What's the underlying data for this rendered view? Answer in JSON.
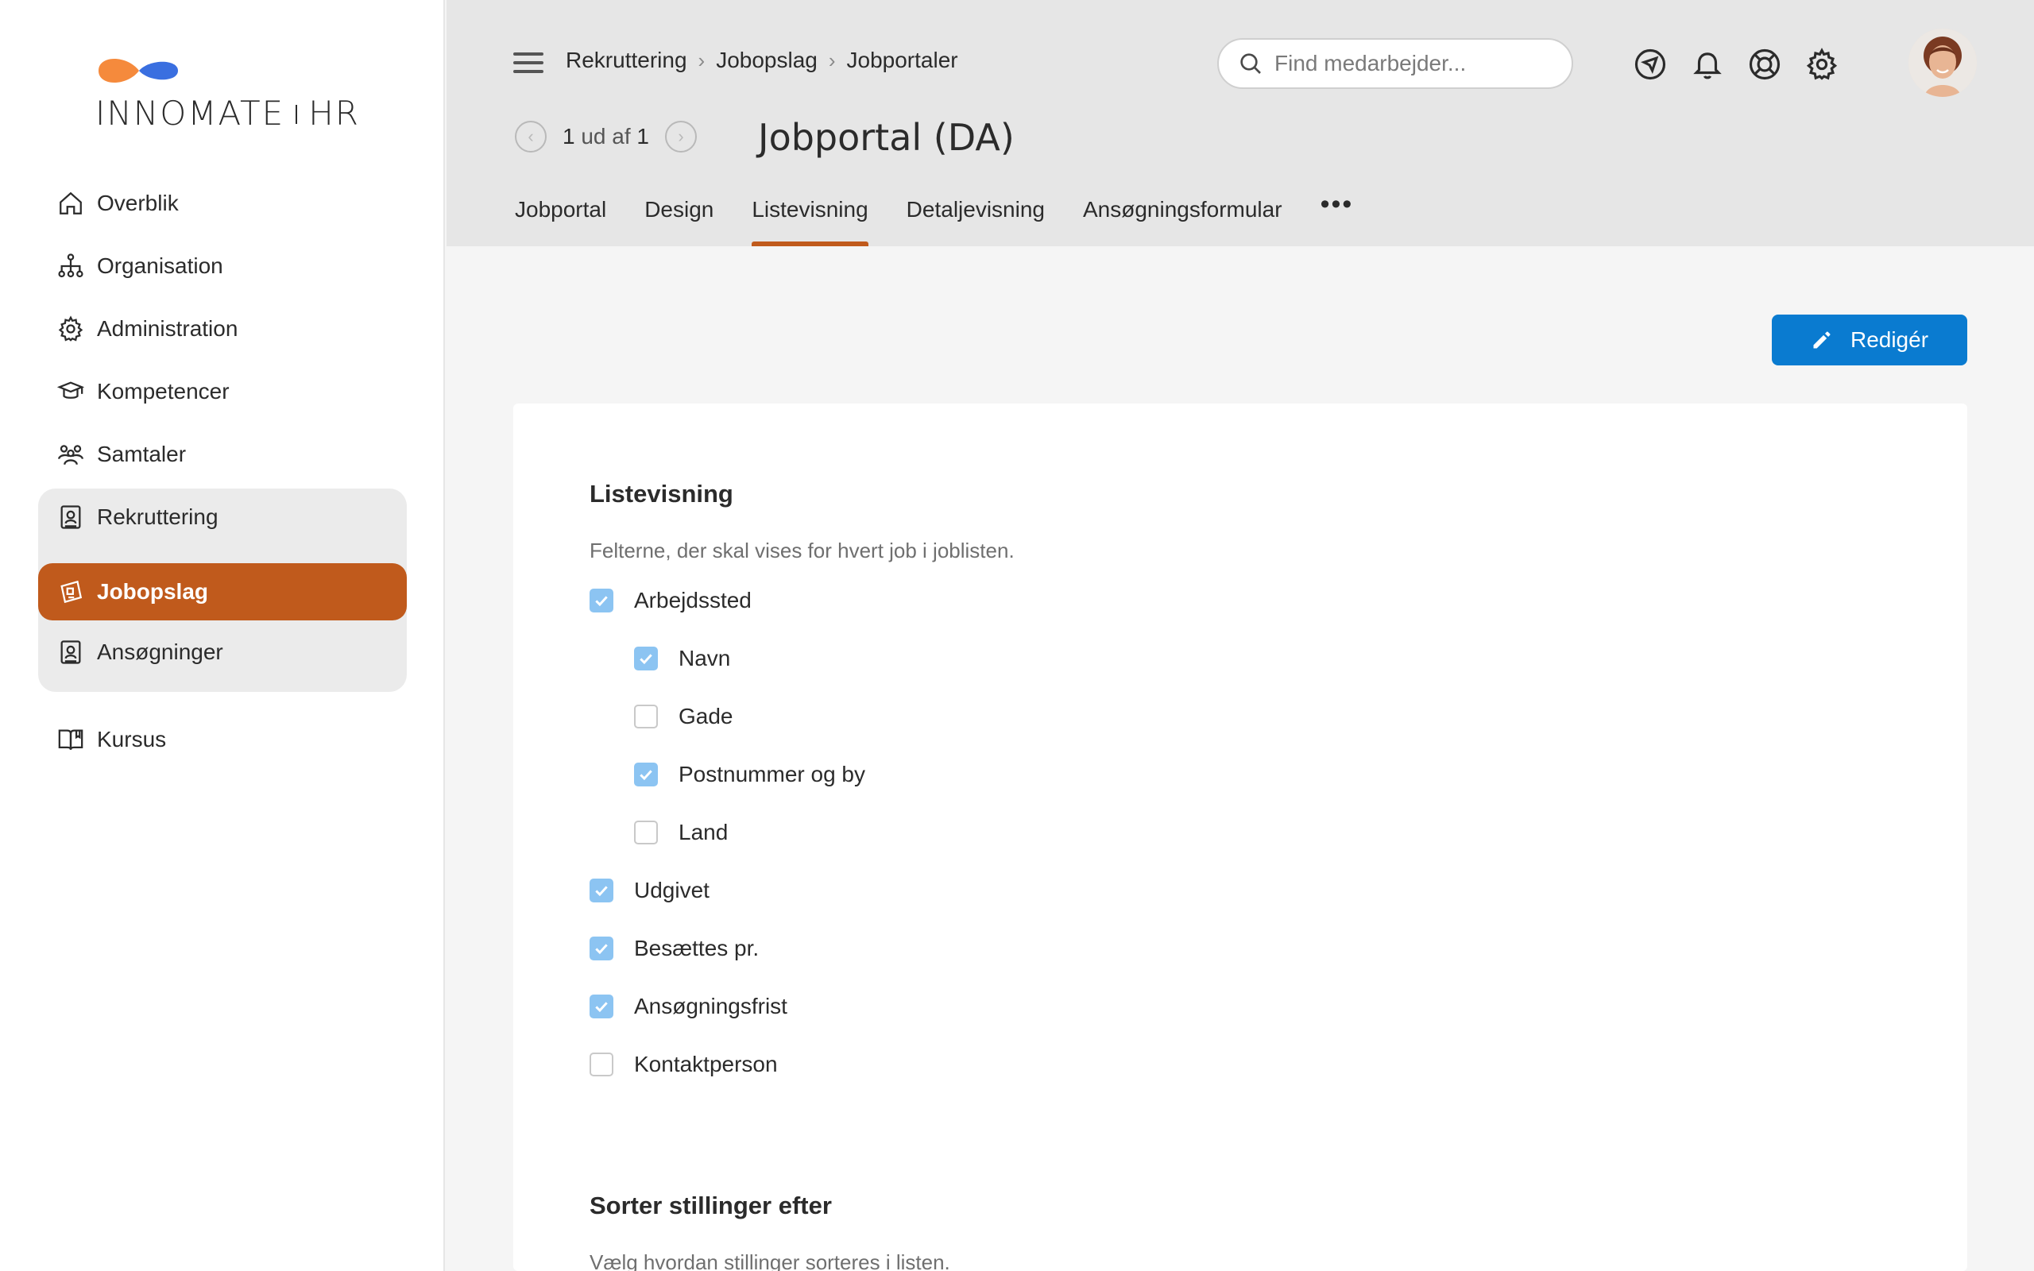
{
  "brand": {
    "name_left": "INNOMATE",
    "name_right": "HR",
    "mark_colors": [
      "#f58a3c",
      "#3a6fe0"
    ]
  },
  "sidebar": {
    "items": [
      {
        "label": "Overblik",
        "icon": "home-icon"
      },
      {
        "label": "Organisation",
        "icon": "org-chart-icon"
      },
      {
        "label": "Administration",
        "icon": "gear-icon"
      },
      {
        "label": "Kompetencer",
        "icon": "graduation-cap-icon"
      },
      {
        "label": "Samtaler",
        "icon": "people-icon"
      },
      {
        "label": "Rekruttering",
        "icon": "id-badge-icon"
      },
      {
        "label": "Jobopslag",
        "icon": "job-post-icon",
        "active": true
      },
      {
        "label": "Ansøgninger",
        "icon": "id-badge-icon"
      },
      {
        "label": "Kursus",
        "icon": "book-icon"
      }
    ]
  },
  "header": {
    "breadcrumb": [
      "Rekruttering",
      "Jobopslag",
      "Jobportaler"
    ],
    "search_placeholder": "Find medarbejder...",
    "pager": {
      "current": "1",
      "separator": "ud af",
      "total": "1"
    },
    "title": "Jobportal (DA)",
    "tabs": [
      {
        "label": "Jobportal"
      },
      {
        "label": "Design"
      },
      {
        "label": "Listevisning",
        "active": true
      },
      {
        "label": "Detaljevisning"
      },
      {
        "label": "Ansøgningsformular"
      }
    ],
    "more_label": "•••",
    "icons": [
      "navigation-icon",
      "bell-icon",
      "lifebuoy-icon",
      "settings-icon"
    ]
  },
  "toolbar": {
    "edit_label": "Redigér",
    "accent": "#0a7bd0"
  },
  "listevisning": {
    "title": "Listevisning",
    "description": "Felterne, der skal vises for hvert job i joblisten.",
    "fields": [
      {
        "label": "Arbejdssted",
        "checked": true,
        "level": 0
      },
      {
        "label": "Navn",
        "checked": true,
        "level": 1
      },
      {
        "label": "Gade",
        "checked": false,
        "level": 1
      },
      {
        "label": "Postnummer og by",
        "checked": true,
        "level": 1
      },
      {
        "label": "Land",
        "checked": false,
        "level": 1
      },
      {
        "label": "Udgivet",
        "checked": true,
        "level": 0
      },
      {
        "label": "Besættes pr.",
        "checked": true,
        "level": 0
      },
      {
        "label": "Ansøgningsfrist",
        "checked": true,
        "level": 0
      },
      {
        "label": "Kontaktperson",
        "checked": false,
        "level": 0
      }
    ]
  },
  "sortering": {
    "title": "Sorter stillinger efter",
    "description": "Vælg hvordan stillinger sorteres i listen."
  },
  "colors": {
    "active_orange": "#c05a1c",
    "checkbox_blue": "#8cc4f2"
  }
}
